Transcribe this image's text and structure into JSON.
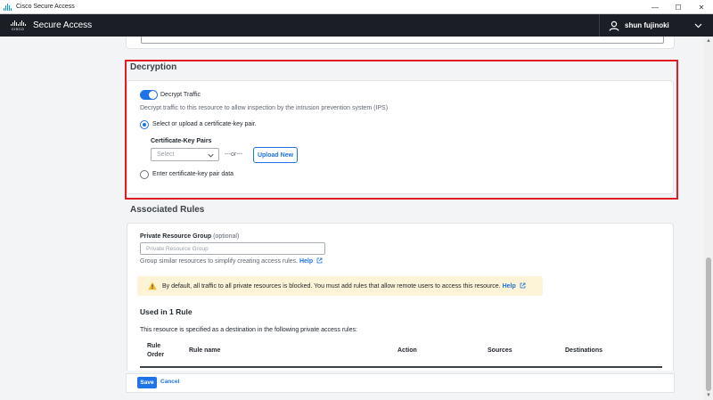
{
  "window": {
    "title": "Cisco Secure Access",
    "controls": {
      "minimize": "—",
      "maximize": "☐",
      "close": "✕"
    }
  },
  "header": {
    "logo_word": "CISCO",
    "app_title": "Secure Access",
    "user_name": "shun fujinoki",
    "icons": {
      "user": "user-icon",
      "menu": "chevron-down-icon"
    }
  },
  "decryption": {
    "section_title": "Decryption",
    "toggle_label": "Decrypt Traffic",
    "toggle_on": true,
    "description": "Decrypt traffic to this resource to allow inspection by the intrusion prevention system (IPS)",
    "option_select": "Select or upload a certificate-key pair.",
    "option_select_checked": true,
    "cert_pairs_label": "Certificate-Key Pairs",
    "select_placeholder": "Select",
    "or_text": "---or---",
    "upload_button": "Upload New",
    "option_enter": "Enter certificate-key pair data",
    "highlight_color": "#e31b23"
  },
  "associated_rules": {
    "section_title": "Associated Rules",
    "prg_label": "Private Resource Group",
    "prg_optional": "(optional)",
    "prg_placeholder": "Private Resource Group",
    "prg_help_text": "Group similar resources to simplify creating access rules.",
    "help_link": "Help",
    "warning_text": "By default, all traffic to all private resources is blocked. You must add rules that allow remote users to access this resource.",
    "warning_link": "Help",
    "used_in_title": "Used in 1 Rule",
    "used_in_desc": "This resource is specified as a destination in the following private access rules:",
    "table_headers": {
      "rule_order_1": "Rule",
      "rule_order_2": "Order",
      "rule_name": "Rule name",
      "action": "Action",
      "sources": "Sources",
      "destinations": "Destinations"
    }
  },
  "footer": {
    "save_label": "Save",
    "cancel_label": "Cancel"
  },
  "colors": {
    "accent": "#1e73e8",
    "header_bg": "#1b1f25",
    "warning_bg": "#fdf3d6"
  }
}
